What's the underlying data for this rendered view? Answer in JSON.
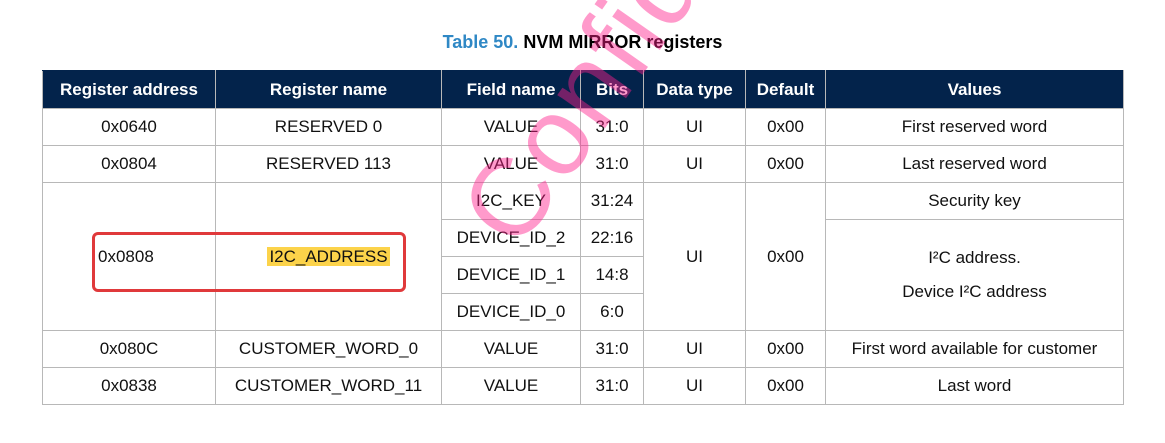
{
  "caption": {
    "number": "Table 50.",
    "title": "NVM MIRROR registers"
  },
  "headers": [
    "Register address",
    "Register name",
    "Field name",
    "Bits",
    "Data type",
    "Default",
    "Values"
  ],
  "rows": [
    {
      "address": "0x0640",
      "name": "RESERVED 0",
      "field": "VALUE",
      "bits": "31:0",
      "type": "UI",
      "default": "0x00",
      "values": "First reserved word"
    },
    {
      "address": "0x0804",
      "name": "RESERVED 113",
      "field": "VALUE",
      "bits": "31:0",
      "type": "UI",
      "default": "0x00",
      "values": "Last reserved word"
    },
    {
      "address": "0x080C",
      "name": "CUSTOMER_WORD_0",
      "field": "VALUE",
      "bits": "31:0",
      "type": "UI",
      "default": "0x00",
      "values": "First word available for customer"
    },
    {
      "address": "0x0838",
      "name": "CUSTOMER_WORD_11",
      "field": "VALUE",
      "bits": "31:0",
      "type": "UI",
      "default": "0x00",
      "values": "Last word"
    }
  ],
  "i2c_group": {
    "address": "0x0808",
    "name": "I2C_ADDRESS",
    "type": "UI",
    "default": "0x00",
    "fields": [
      {
        "field": "I2C_KEY",
        "bits": "31:24"
      },
      {
        "field": "DEVICE_ID_2",
        "bits": "22:16"
      },
      {
        "field": "DEVICE_ID_1",
        "bits": "14:8"
      },
      {
        "field": "DEVICE_ID_0",
        "bits": "6:0"
      }
    ],
    "value_key": "Security key",
    "value_line1": "I²C address.",
    "value_line2": "Device I²C address"
  },
  "watermark": "Confidential",
  "colors": {
    "header_bg": "#03234b",
    "caption_number": "#2f88c5",
    "highlight": "#fcd34a",
    "annotation_box": "#e0393b",
    "watermark": "#ff1e8c"
  }
}
